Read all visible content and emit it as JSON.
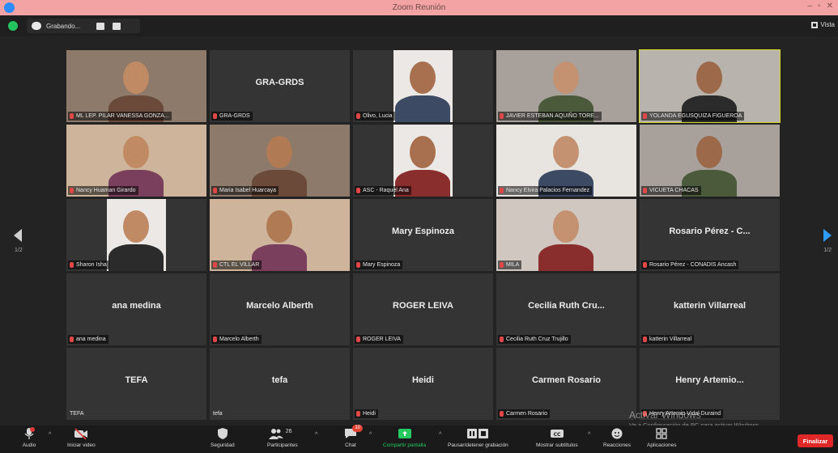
{
  "window": {
    "title": "Zoom Reunión",
    "controls": [
      "–",
      "▫",
      "✕"
    ]
  },
  "topbar": {
    "recording_label": "Grabando...",
    "view_label": "Vista"
  },
  "pagination": {
    "left": "1/2",
    "right": "1/2"
  },
  "participants": [
    {
      "id": "p1",
      "tag": "ML LEP. PILAR VANESSA GONZA...",
      "big": "",
      "video": true
    },
    {
      "id": "p2",
      "tag": "GRA-GRDS",
      "big": "GRA-GRDS",
      "video": false
    },
    {
      "id": "p3",
      "tag": "Olivo, Lucia",
      "big": "",
      "video": true
    },
    {
      "id": "p4",
      "tag": "JAVIER ESTEBAN AQUIÑO TORE...",
      "big": "",
      "video": true
    },
    {
      "id": "p5",
      "tag": "YOLANDA EGUSQUIZA FIGUEROA",
      "big": "",
      "video": true
    },
    {
      "id": "p6",
      "tag": "Nancy Huaman Girardo",
      "big": "",
      "video": true
    },
    {
      "id": "p7",
      "tag": "Maria Isabel Huarcaya",
      "big": "",
      "video": true
    },
    {
      "id": "p8",
      "tag": "ASC - Raquel Ana",
      "big": "",
      "video": true
    },
    {
      "id": "p9",
      "tag": "Nancy Elvira Palacios Fernandez",
      "big": "",
      "video": true
    },
    {
      "id": "p10",
      "tag": "VICUETA CHACAS",
      "big": "",
      "video": true
    },
    {
      "id": "p11",
      "tag": "Sharon Isha",
      "big": "",
      "video": true
    },
    {
      "id": "p12",
      "tag": "CTL EL VILLAR",
      "big": "",
      "video": true
    },
    {
      "id": "p13",
      "tag": "Mary Espinoza",
      "big": "Mary Espinoza",
      "video": false
    },
    {
      "id": "p14",
      "tag": "MILA",
      "big": "",
      "video": true
    },
    {
      "id": "p15",
      "tag": "Rosario Pérez - CONADIS Ancash",
      "big": "Rosario Pérez - C...",
      "video": false
    },
    {
      "id": "p16",
      "tag": "ana medina",
      "big": "ana medina",
      "video": false
    },
    {
      "id": "p17",
      "tag": "Marcelo Alberth",
      "big": "Marcelo Alberth",
      "video": false
    },
    {
      "id": "p18",
      "tag": "ROGER LEIVA",
      "big": "ROGER LEIVA",
      "video": false
    },
    {
      "id": "p19",
      "tag": "Cecilia Ruth Cruz Trujillo",
      "big": "Cecilia Ruth Cru...",
      "video": false
    },
    {
      "id": "p20",
      "tag": "katterin Villarreal",
      "big": "katterin Villarreal",
      "video": false
    },
    {
      "id": "p21",
      "tag": "TEFA",
      "big": "TEFA",
      "video": false
    },
    {
      "id": "p22",
      "tag": "tefa",
      "big": "tefa",
      "video": false
    },
    {
      "id": "p23",
      "tag": "Heidi",
      "big": "Heidi",
      "video": false
    },
    {
      "id": "p24",
      "tag": "Carmen Rosario",
      "big": "Carmen Rosario",
      "video": false
    },
    {
      "id": "p25",
      "tag": "Henry Artemio Vidal Duraind",
      "big": "Henry Artemio...",
      "video": false
    }
  ],
  "toolbar": {
    "audio": "Audio",
    "video": "Iniciar video",
    "security": "Seguridad",
    "participants": "Participantes",
    "participants_count": "26",
    "chat": "Chat",
    "chat_badge": "10",
    "share": "Compartir pantalla",
    "record": "Pausar/detener grabación",
    "captions": "Mostrar subtítulos",
    "reactions": "Reacciones",
    "apps": "Aplicaciones",
    "end": "Finalizar"
  },
  "watermark": {
    "line1": "Activar Windows",
    "line2": "Ve a Configuración de PC para activar Windows."
  },
  "colors": {
    "active_speaker": "#d8d82a",
    "share_green": "#25c95f",
    "end_red": "#e02828",
    "titlebar": "#f3a3a3"
  }
}
